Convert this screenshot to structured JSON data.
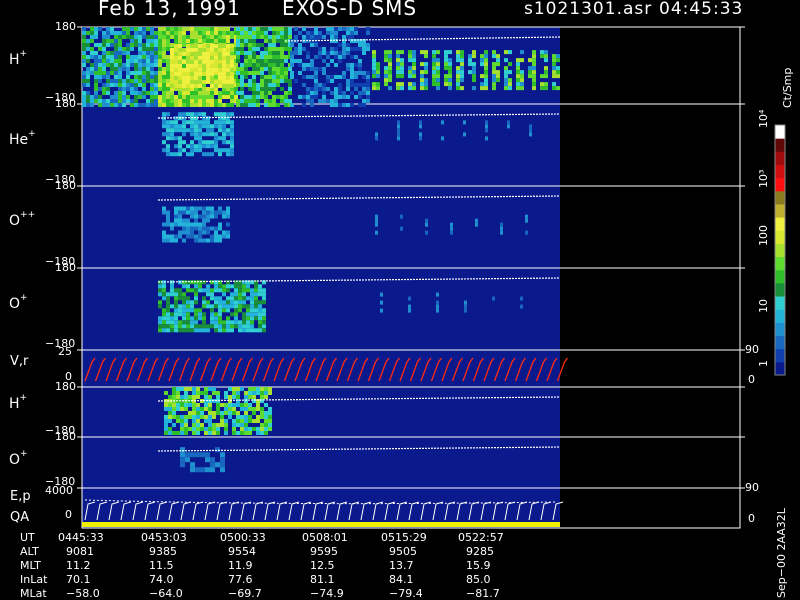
{
  "header": {
    "date": "Feb 13, 1991",
    "instrument": "EXOS-D SMS",
    "file": "s1021301.asr",
    "time": "04:45:33"
  },
  "colorbar": {
    "unit": "Ct/Smp",
    "ticks": [
      "1",
      "10",
      "100",
      "10³",
      "10⁴"
    ],
    "colors": [
      "#0a1a8c",
      "#1040b0",
      "#1868c0",
      "#1f8fd0",
      "#23b3d8",
      "#30cfd0",
      "#1a8f3a",
      "#2fbf2a",
      "#5fdb30",
      "#a8e030",
      "#d8e830",
      "#f0f040",
      "#c0b030",
      "#8a7a20",
      "#ff1010",
      "#d01010",
      "#a00c0c",
      "#600808",
      "#ffffff"
    ]
  },
  "panels": [
    {
      "species": "H",
      "charge": "+",
      "ymax": "180",
      "ymin": "−180"
    },
    {
      "species": "He",
      "charge": "+",
      "ymax": "180",
      "ymin": "−180"
    },
    {
      "species": "O",
      "charge": "++",
      "ymax": "180",
      "ymin": "−180"
    },
    {
      "species": "O",
      "charge": "+",
      "ymax": "180",
      "ymin": "−180"
    },
    {
      "species": "H",
      "charge": "+",
      "ymax": "180",
      "ymin": "−180"
    },
    {
      "species": "O",
      "charge": "+",
      "ymax": "180",
      "ymin": "−180"
    }
  ],
  "vr_panel": {
    "label": "V,r",
    "ymax": "25",
    "ymin": "0",
    "right_max": "90",
    "right_min": "0",
    "color": "#ff2a10"
  },
  "ep_panel": {
    "label1": "E,p",
    "label2": "QA",
    "ymax": "4000",
    "ymin": "0",
    "right_max": "90",
    "right_min": "0",
    "qa_color": "#f0f000"
  },
  "orbit_table": {
    "rows": [
      {
        "name": "UT",
        "values": [
          "0445:33",
          "0453:03",
          "0500:33",
          "0508:01",
          "0515:29",
          "0522:57"
        ]
      },
      {
        "name": "ALT",
        "values": [
          "9081",
          "9385",
          "9554",
          "9595",
          "9505",
          "9285"
        ]
      },
      {
        "name": "MLT",
        "values": [
          "11.2",
          "11.5",
          "11.9",
          "12.5",
          "13.7",
          "15.9"
        ]
      },
      {
        "name": "InLat",
        "values": [
          "70.1",
          "74.0",
          "77.6",
          "81.1",
          "84.1",
          "85.0"
        ]
      },
      {
        "name": "MLat",
        "values": [
          "−58.0",
          "−64.0",
          "−69.7",
          "−74.9",
          "−79.4",
          "−81.7"
        ]
      }
    ]
  },
  "footer_stamp": "Sep−00 2AA32L",
  "chart_data": {
    "type": "heatmap",
    "x_axis": "UT",
    "x": [
      "0445:33",
      "0453:03",
      "0500:33",
      "0508:01",
      "0515:29",
      "0522:57"
    ],
    "y_range_pitch_panels": [
      -180,
      180
    ],
    "count_scale_log": [
      1,
      10000
    ],
    "panels": [
      {
        "name": "H+",
        "activity": [
          {
            "from": "0445:33",
            "to": "0452:30",
            "level": "green"
          },
          {
            "from": "0452:30",
            "to": "0458:30",
            "level": "yellow"
          },
          {
            "from": "0458:30",
            "to": "0503:30",
            "level": "green"
          },
          {
            "from": "0503:30",
            "to": "0508:00",
            "level": "cyan"
          },
          {
            "from": "0508:00",
            "to": "0522:57",
            "level": "green bursts"
          }
        ]
      },
      {
        "name": "He+",
        "activity": [
          {
            "from": "0453:00",
            "to": "0459:00",
            "level": "cyan"
          }
        ]
      },
      {
        "name": "O++",
        "activity": [
          {
            "from": "0453:00",
            "to": "0459:00",
            "level": "cyan"
          }
        ]
      },
      {
        "name": "O+",
        "activity": [
          {
            "from": "0453:00",
            "to": "0500:30",
            "level": "green"
          }
        ]
      },
      {
        "name": "H+ (2)",
        "activity": [
          {
            "from": "0453:00",
            "to": "0503:30",
            "level": "green"
          }
        ]
      },
      {
        "name": "O+ (2)",
        "activity": [
          {
            "from": "0455:00",
            "to": "0500:00",
            "level": "blue"
          }
        ]
      }
    ]
  }
}
